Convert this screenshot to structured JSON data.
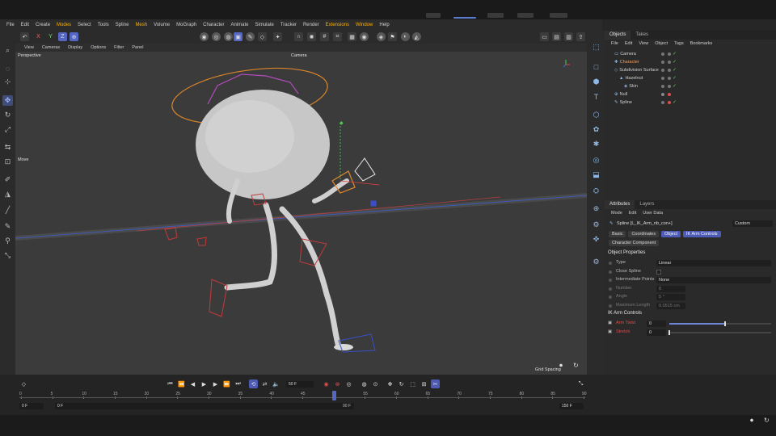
{
  "menubar": {
    "items": [
      "File",
      "Edit",
      "Create",
      "Modes",
      "Select",
      "Tools",
      "Spline",
      "Mesh",
      "Volume",
      "MoGraph",
      "Character",
      "Animate",
      "Simulate",
      "Tracker",
      "Render",
      "Extensions",
      "Window",
      "Help"
    ],
    "highlighted": [
      "Modes",
      "Mesh",
      "Extensions",
      "Window"
    ]
  },
  "toolbar": {
    "axis_x": "X",
    "axis_y": "Y",
    "axis_z": "Z"
  },
  "viewport": {
    "menu": [
      "View",
      "Cameras",
      "Display",
      "Options",
      "Filter",
      "Panel"
    ],
    "label": "Perspective",
    "camera": "Camera",
    "move_label": "Move",
    "grid_spacing": "Grid Spacing"
  },
  "objects_panel": {
    "tabs": [
      "Objects",
      "Takes"
    ],
    "menu": [
      "File",
      "Edit",
      "View",
      "Object",
      "Tags",
      "Bookmarks"
    ],
    "rows": [
      {
        "name": "Camera",
        "selected": false
      },
      {
        "name": "Character",
        "selected": true
      },
      {
        "name": "Subdivision Surface",
        "selected": false
      },
      {
        "name": "Hazelnut",
        "selected": false
      },
      {
        "name": "Skin",
        "selected": false
      },
      {
        "name": "Null",
        "selected": false
      },
      {
        "name": "Spline",
        "selected": false
      }
    ]
  },
  "attributes_panel": {
    "tabs": [
      "Attributes",
      "Layers"
    ],
    "menu": [
      "Mode",
      "Edit",
      "User Data"
    ],
    "object_title": "Spline [L_IK_Arm_nb_con+]",
    "preset": "Custom",
    "tabs_row": [
      "Basic",
      "Coordinates",
      "Object",
      "IK Arm Controls"
    ],
    "active_tabs": [
      "Object",
      "IK Arm Controls"
    ],
    "character_component": "Character Component",
    "section_object": "Object Properties",
    "properties": [
      {
        "label": "Type",
        "value": "Linear",
        "dim": false
      },
      {
        "label": "Close Spline",
        "value": "",
        "dim": false
      },
      {
        "label": "Intermediate Points",
        "value": "None",
        "dim": false
      },
      {
        "label": "Number",
        "value": "8",
        "dim": true
      },
      {
        "label": "Angle",
        "value": "5 °",
        "dim": true
      },
      {
        "label": "Maximum Length",
        "value": "0.0515 cm",
        "dim": true
      }
    ],
    "section_ik": "IK Arm Controls",
    "ik_properties": [
      {
        "label": "Arm Twist",
        "value": "0",
        "slider": 0.55
      },
      {
        "label": "Stretch",
        "value": "0",
        "slider": 0.0
      }
    ]
  },
  "timeline": {
    "current_frame": "50 F",
    "ruler_ticks": [
      "0",
      "5",
      "10",
      "15",
      "20",
      "25",
      "30",
      "35",
      "40",
      "45",
      "50",
      "55",
      "60",
      "65",
      "70",
      "75",
      "80",
      "85",
      "90"
    ],
    "playhead_frame": 50,
    "start_field": "0 F",
    "start_field2": "0 F",
    "mid_field": "90 F",
    "end_field": "150 F"
  },
  "colors": {
    "accent_blue": "#5566c4",
    "selected_orange": "#ff9a50",
    "ik_red": "#e24b4b",
    "check_green": "#4ccf4c"
  }
}
